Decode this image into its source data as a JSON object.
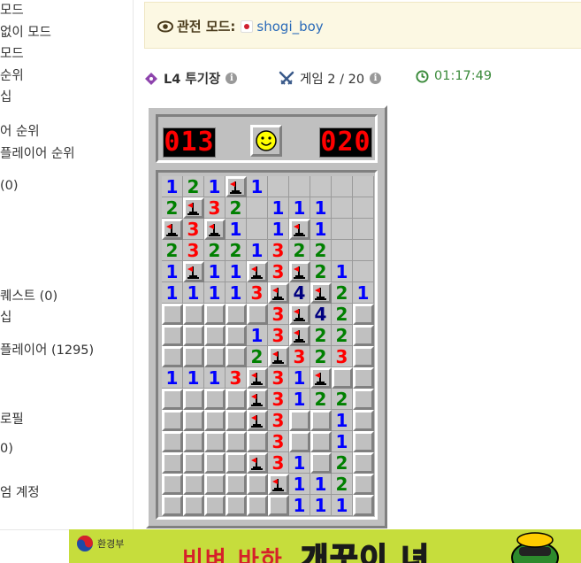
{
  "sidebar": {
    "items": [
      {
        "label": "모드"
      },
      {
        "label": "없이 모드"
      },
      {
        "label": "모드"
      },
      {
        "label": "순위"
      },
      {
        "label": "십"
      },
      {
        "label": "어 순위"
      },
      {
        "label": "플레이어 순위"
      },
      {
        "label": "(0)"
      },
      {
        "label": "퀘스트 (0)"
      },
      {
        "label": "십"
      },
      {
        "label": "플레이어 (1295)"
      },
      {
        "label": "로필"
      },
      {
        "label": "0)"
      },
      {
        "label": "엄 계정"
      }
    ]
  },
  "banner": {
    "label": "관전 모드:",
    "player": "shogi_boy"
  },
  "info": {
    "arena": "L4 투기장",
    "game": "게임 2 / 20",
    "timer": "01:17:49"
  },
  "game": {
    "mines_left": "013",
    "time": "020",
    "face": "smile-icon",
    "rows": [
      "121F1.....",
      "2F32.111..",
      "F3F1.1F1..",
      "23221322..",
      "1F11F3F21.",
      "1111 3F4F21",
      "#####3F42##",
      "####13F22##",
      "####2F323##",
      "1113F31F##",
      "####F3122#",
      "####F3##1#",
      "#####3##1#",
      "####F31#2#",
      "#####F112#",
      "######111##"
    ]
  },
  "ad": {
    "ministry": "환경부",
    "text1": "비벼 바하",
    "text2": "개끗이 녀"
  },
  "colors": {
    "accent_purple": "#8e44ad",
    "info_blue": "#2a6ab8",
    "timer_green": "#3a8a3a",
    "banner_bg": "#fcf8e3"
  }
}
